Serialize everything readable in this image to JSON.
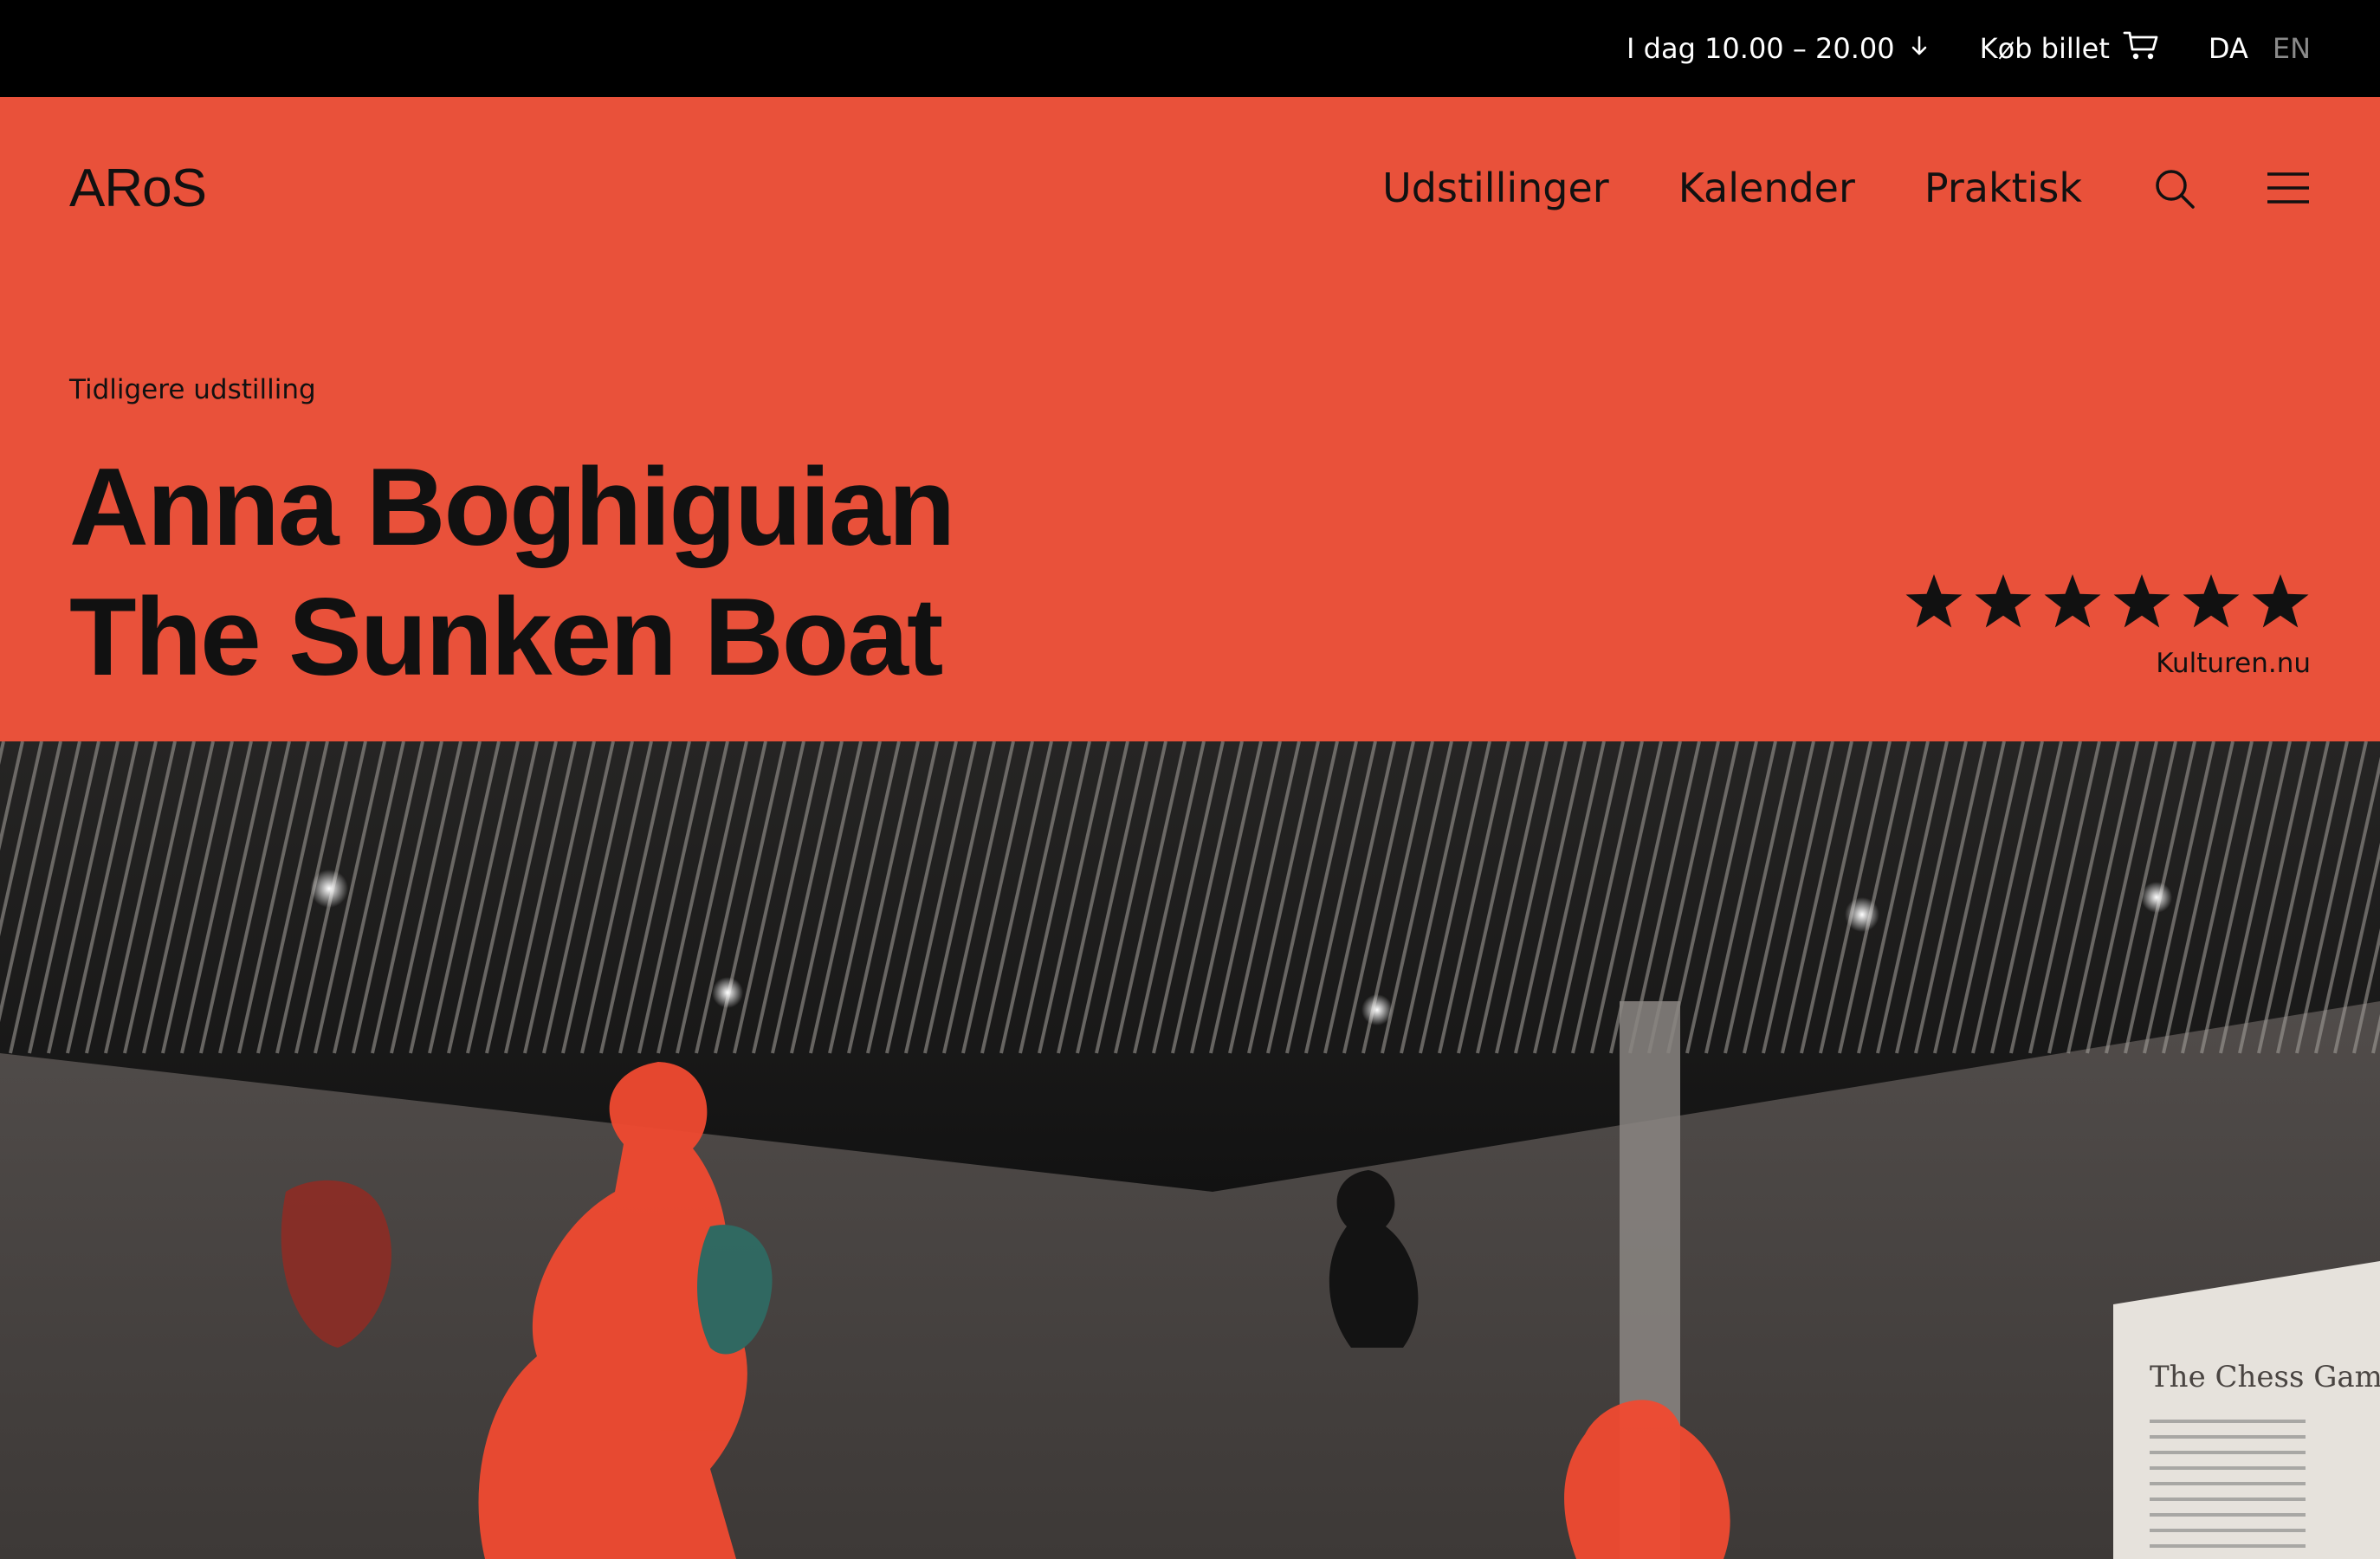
{
  "topbar": {
    "hours": "I dag 10.00 – 20.00",
    "ticket": "Køb billet",
    "lang_da": "DA",
    "lang_en": "EN"
  },
  "header": {
    "logo": "ARoS",
    "nav": [
      "Udstillinger",
      "Kalender",
      "Praktisk"
    ]
  },
  "exhibition": {
    "status": "Tidligere udstilling",
    "title_line1": "Anna Boghiguian",
    "title_line2": "The Sunken Boat",
    "rating": {
      "stars": 6,
      "source": "Kulturen.nu"
    }
  },
  "hero_image": {
    "wall_text_title": "The Chess Game"
  },
  "colors": {
    "topbar_bg": "#000000",
    "accent": "#e9513a",
    "text": "#111111"
  },
  "icons": {
    "hours": "arrow-down-icon",
    "ticket": "cart-icon",
    "search": "search-icon",
    "menu": "hamburger-menu-icon",
    "rating": "star-icon"
  }
}
